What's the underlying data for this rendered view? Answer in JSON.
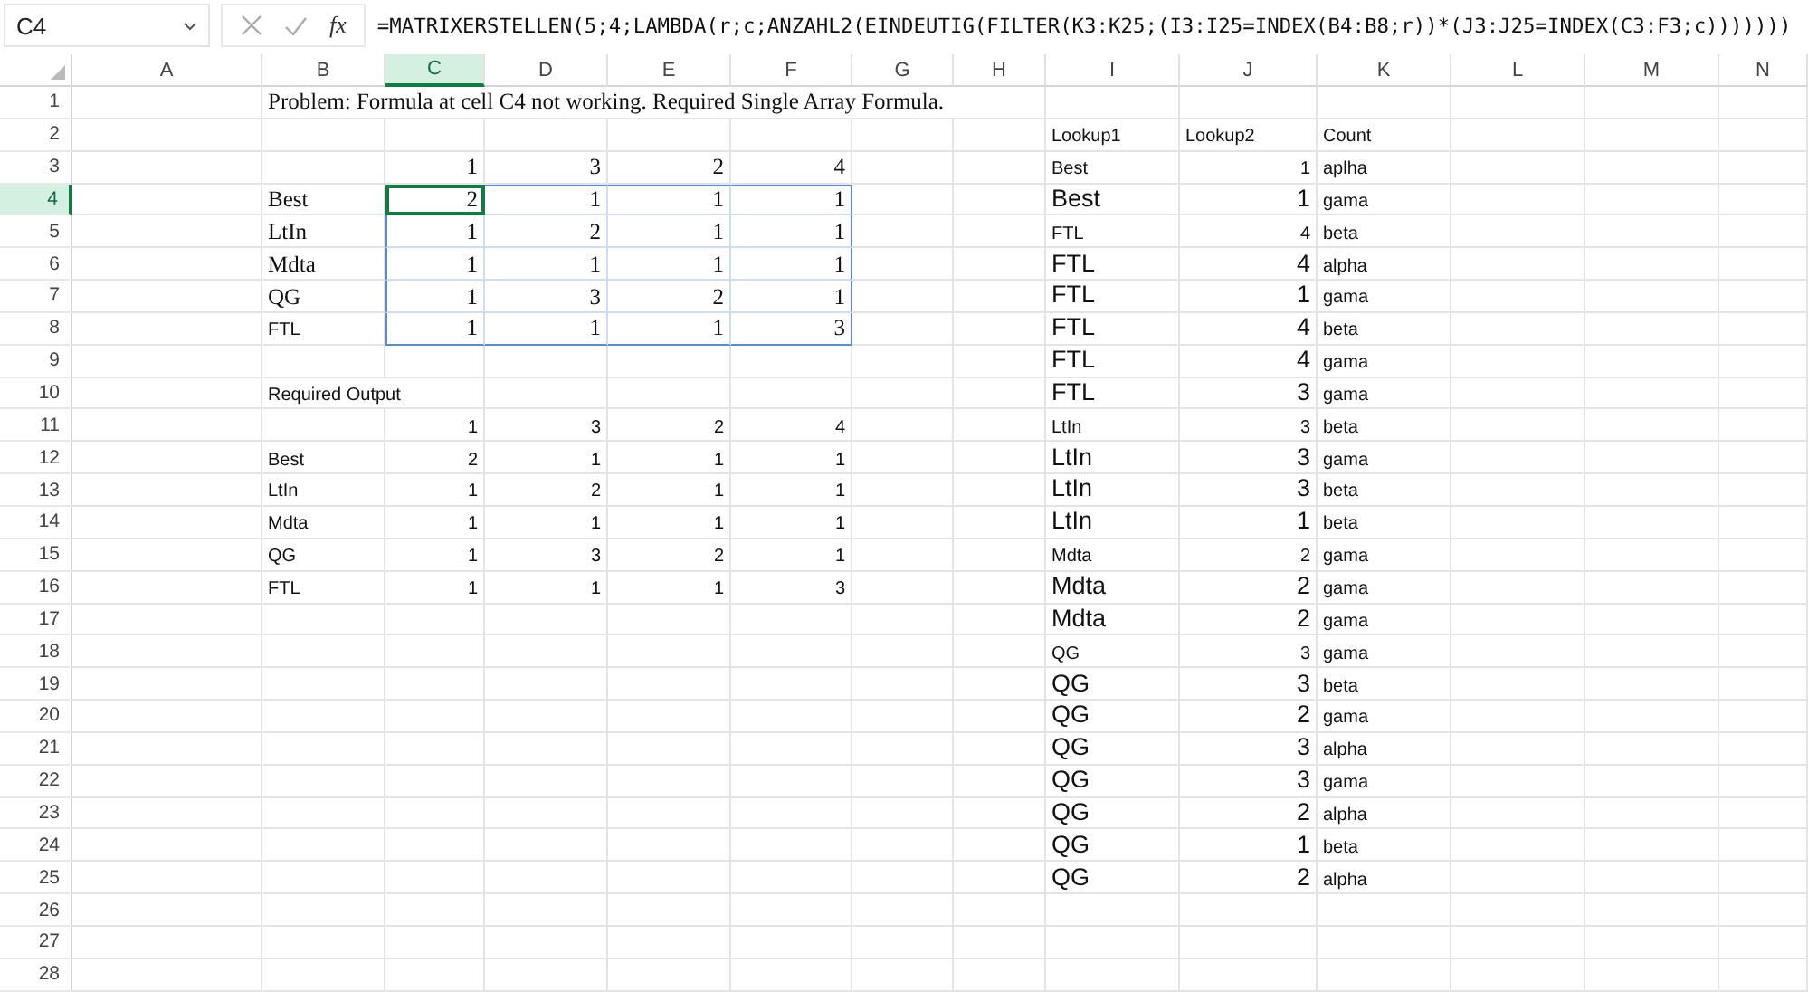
{
  "formula_bar": {
    "name_box": "C4",
    "function_label": "fx",
    "formula": "=MATRIXERSTELLEN(5;4;LAMBDA(r;c;ANZAHL2(EINDEUTIG(FILTER(K3:K25;(I3:I25=INDEX(B4:B8;r))*(J3:J25=INDEX(C3:F3;c)))))))"
  },
  "columns": [
    {
      "label": "A",
      "selected": false
    },
    {
      "label": "B",
      "selected": false
    },
    {
      "label": "C",
      "selected": true
    },
    {
      "label": "D",
      "selected": false
    },
    {
      "label": "E",
      "selected": false
    },
    {
      "label": "F",
      "selected": false
    },
    {
      "label": "G",
      "selected": false
    },
    {
      "label": "H",
      "selected": false
    },
    {
      "label": "I",
      "selected": false
    },
    {
      "label": "J",
      "selected": false
    },
    {
      "label": "K",
      "selected": false
    },
    {
      "label": "L",
      "selected": false
    },
    {
      "label": "M",
      "selected": false
    },
    {
      "label": "N",
      "selected": false
    }
  ],
  "rows": [
    {
      "number": "1",
      "selected": false,
      "cells": {
        "B": {
          "text": "Problem: Formula at cell C4 not working. Required Single Array Formula.",
          "kind": "serif_text",
          "active": false,
          "spill": false
        }
      }
    },
    {
      "number": "2",
      "selected": false,
      "cells": {
        "I": {
          "text": "Lookup1",
          "kind": "sans_text",
          "active": false,
          "spill": false
        },
        "J": {
          "text": "Lookup2",
          "kind": "sans_text",
          "active": false,
          "spill": false
        },
        "K": {
          "text": "Count",
          "kind": "sans_text",
          "active": false,
          "spill": false
        }
      }
    },
    {
      "number": "3",
      "selected": false,
      "cells": {
        "C": {
          "text": "1",
          "kind": "serif_num",
          "active": false,
          "spill": false
        },
        "D": {
          "text": "3",
          "kind": "serif_num",
          "active": false,
          "spill": false
        },
        "E": {
          "text": "2",
          "kind": "serif_num",
          "active": false,
          "spill": false
        },
        "F": {
          "text": "4",
          "kind": "serif_num",
          "active": false,
          "spill": false
        },
        "I": {
          "text": "Best",
          "kind": "sans_text",
          "active": false,
          "spill": false
        },
        "J": {
          "text": "1",
          "kind": "sans_num",
          "active": false,
          "spill": false
        },
        "K": {
          "text": "aplha",
          "kind": "sans_text",
          "active": false,
          "spill": false
        }
      }
    },
    {
      "number": "4",
      "selected": true,
      "cells": {
        "B": {
          "text": "Best",
          "kind": "serif_text",
          "active": false,
          "spill": false
        },
        "C": {
          "text": "2",
          "kind": "serif_num",
          "active": true,
          "spill": true
        },
        "D": {
          "text": "1",
          "kind": "serif_num",
          "active": false,
          "spill": true
        },
        "E": {
          "text": "1",
          "kind": "serif_num",
          "active": false,
          "spill": true
        },
        "F": {
          "text": "1",
          "kind": "serif_num",
          "active": false,
          "spill": true
        },
        "I": {
          "text": "Best",
          "kind": "large_text",
          "active": false,
          "spill": false
        },
        "J": {
          "text": "1",
          "kind": "large_num",
          "active": false,
          "spill": false
        },
        "K": {
          "text": "gama",
          "kind": "sans_text",
          "active": false,
          "spill": false
        }
      }
    },
    {
      "number": "5",
      "selected": false,
      "cells": {
        "B": {
          "text": "LtIn",
          "kind": "serif_text",
          "active": false,
          "spill": false
        },
        "C": {
          "text": "1",
          "kind": "serif_num",
          "active": false,
          "spill": true
        },
        "D": {
          "text": "2",
          "kind": "serif_num",
          "active": false,
          "spill": true
        },
        "E": {
          "text": "1",
          "kind": "serif_num",
          "active": false,
          "spill": true
        },
        "F": {
          "text": "1",
          "kind": "serif_num",
          "active": false,
          "spill": true
        },
        "I": {
          "text": "FTL",
          "kind": "sans_text",
          "active": false,
          "spill": false
        },
        "J": {
          "text": "4",
          "kind": "sans_num",
          "active": false,
          "spill": false
        },
        "K": {
          "text": "beta",
          "kind": "sans_text",
          "active": false,
          "spill": false
        }
      }
    },
    {
      "number": "6",
      "selected": false,
      "cells": {
        "B": {
          "text": "Mdta",
          "kind": "serif_text",
          "active": false,
          "spill": false
        },
        "C": {
          "text": "1",
          "kind": "serif_num",
          "active": false,
          "spill": true
        },
        "D": {
          "text": "1",
          "kind": "serif_num",
          "active": false,
          "spill": true
        },
        "E": {
          "text": "1",
          "kind": "serif_num",
          "active": false,
          "spill": true
        },
        "F": {
          "text": "1",
          "kind": "serif_num",
          "active": false,
          "spill": true
        },
        "I": {
          "text": "FTL",
          "kind": "large_text",
          "active": false,
          "spill": false
        },
        "J": {
          "text": "4",
          "kind": "large_num",
          "active": false,
          "spill": false
        },
        "K": {
          "text": "alpha",
          "kind": "sans_text",
          "active": false,
          "spill": false
        }
      }
    },
    {
      "number": "7",
      "selected": false,
      "cells": {
        "B": {
          "text": "QG",
          "kind": "serif_text",
          "active": false,
          "spill": false
        },
        "C": {
          "text": "1",
          "kind": "serif_num",
          "active": false,
          "spill": true
        },
        "D": {
          "text": "3",
          "kind": "serif_num",
          "active": false,
          "spill": true
        },
        "E": {
          "text": "2",
          "kind": "serif_num",
          "active": false,
          "spill": true
        },
        "F": {
          "text": "1",
          "kind": "serif_num",
          "active": false,
          "spill": true
        },
        "I": {
          "text": "FTL",
          "kind": "large_text",
          "active": false,
          "spill": false
        },
        "J": {
          "text": "1",
          "kind": "large_num",
          "active": false,
          "spill": false
        },
        "K": {
          "text": "gama",
          "kind": "sans_text",
          "active": false,
          "spill": false
        }
      }
    },
    {
      "number": "8",
      "selected": false,
      "cells": {
        "B": {
          "text": "FTL",
          "kind": "sans_text",
          "active": false,
          "spill": false
        },
        "C": {
          "text": "1",
          "kind": "serif_num",
          "active": false,
          "spill": true
        },
        "D": {
          "text": "1",
          "kind": "serif_num",
          "active": false,
          "spill": true
        },
        "E": {
          "text": "1",
          "kind": "serif_num",
          "active": false,
          "spill": true
        },
        "F": {
          "text": "3",
          "kind": "serif_num",
          "active": false,
          "spill": true
        },
        "I": {
          "text": "FTL",
          "kind": "large_text",
          "active": false,
          "spill": false
        },
        "J": {
          "text": "4",
          "kind": "large_num",
          "active": false,
          "spill": false
        },
        "K": {
          "text": "beta",
          "kind": "sans_text",
          "active": false,
          "spill": false
        }
      }
    },
    {
      "number": "9",
      "selected": false,
      "cells": {
        "I": {
          "text": "FTL",
          "kind": "large_text",
          "active": false,
          "spill": false
        },
        "J": {
          "text": "4",
          "kind": "large_num",
          "active": false,
          "spill": false
        },
        "K": {
          "text": "gama",
          "kind": "sans_text",
          "active": false,
          "spill": false
        }
      }
    },
    {
      "number": "10",
      "selected": false,
      "cells": {
        "B": {
          "text": "Required Output",
          "kind": "sans_text",
          "active": false,
          "spill": false
        },
        "I": {
          "text": "FTL",
          "kind": "large_text",
          "active": false,
          "spill": false
        },
        "J": {
          "text": "3",
          "kind": "large_num",
          "active": false,
          "spill": false
        },
        "K": {
          "text": "gama",
          "kind": "sans_text",
          "active": false,
          "spill": false
        }
      }
    },
    {
      "number": "11",
      "selected": false,
      "cells": {
        "C": {
          "text": "1",
          "kind": "sans_num",
          "active": false,
          "spill": false
        },
        "D": {
          "text": "3",
          "kind": "sans_num",
          "active": false,
          "spill": false
        },
        "E": {
          "text": "2",
          "kind": "sans_num",
          "active": false,
          "spill": false
        },
        "F": {
          "text": "4",
          "kind": "sans_num",
          "active": false,
          "spill": false
        },
        "I": {
          "text": "LtIn",
          "kind": "sans_text",
          "active": false,
          "spill": false
        },
        "J": {
          "text": "3",
          "kind": "sans_num",
          "active": false,
          "spill": false
        },
        "K": {
          "text": "beta",
          "kind": "sans_text",
          "active": false,
          "spill": false
        }
      }
    },
    {
      "number": "12",
      "selected": false,
      "cells": {
        "B": {
          "text": "Best",
          "kind": "sans_text",
          "active": false,
          "spill": false
        },
        "C": {
          "text": "2",
          "kind": "sans_num",
          "active": false,
          "spill": false
        },
        "D": {
          "text": "1",
          "kind": "sans_num",
          "active": false,
          "spill": false
        },
        "E": {
          "text": "1",
          "kind": "sans_num",
          "active": false,
          "spill": false
        },
        "F": {
          "text": "1",
          "kind": "sans_num",
          "active": false,
          "spill": false
        },
        "I": {
          "text": "LtIn",
          "kind": "large_text",
          "active": false,
          "spill": false
        },
        "J": {
          "text": "3",
          "kind": "large_num",
          "active": false,
          "spill": false
        },
        "K": {
          "text": "gama",
          "kind": "sans_text",
          "active": false,
          "spill": false
        }
      }
    },
    {
      "number": "13",
      "selected": false,
      "cells": {
        "B": {
          "text": "LtIn",
          "kind": "sans_text",
          "active": false,
          "spill": false
        },
        "C": {
          "text": "1",
          "kind": "sans_num",
          "active": false,
          "spill": false
        },
        "D": {
          "text": "2",
          "kind": "sans_num",
          "active": false,
          "spill": false
        },
        "E": {
          "text": "1",
          "kind": "sans_num",
          "active": false,
          "spill": false
        },
        "F": {
          "text": "1",
          "kind": "sans_num",
          "active": false,
          "spill": false
        },
        "I": {
          "text": "LtIn",
          "kind": "large_text",
          "active": false,
          "spill": false
        },
        "J": {
          "text": "3",
          "kind": "large_num",
          "active": false,
          "spill": false
        },
        "K": {
          "text": "beta",
          "kind": "sans_text",
          "active": false,
          "spill": false
        }
      }
    },
    {
      "number": "14",
      "selected": false,
      "cells": {
        "B": {
          "text": "Mdta",
          "kind": "sans_text",
          "active": false,
          "spill": false
        },
        "C": {
          "text": "1",
          "kind": "sans_num",
          "active": false,
          "spill": false
        },
        "D": {
          "text": "1",
          "kind": "sans_num",
          "active": false,
          "spill": false
        },
        "E": {
          "text": "1",
          "kind": "sans_num",
          "active": false,
          "spill": false
        },
        "F": {
          "text": "1",
          "kind": "sans_num",
          "active": false,
          "spill": false
        },
        "I": {
          "text": "LtIn",
          "kind": "large_text",
          "active": false,
          "spill": false
        },
        "J": {
          "text": "1",
          "kind": "large_num",
          "active": false,
          "spill": false
        },
        "K": {
          "text": "beta",
          "kind": "sans_text",
          "active": false,
          "spill": false
        }
      }
    },
    {
      "number": "15",
      "selected": false,
      "cells": {
        "B": {
          "text": "QG",
          "kind": "sans_text",
          "active": false,
          "spill": false
        },
        "C": {
          "text": "1",
          "kind": "sans_num",
          "active": false,
          "spill": false
        },
        "D": {
          "text": "3",
          "kind": "sans_num",
          "active": false,
          "spill": false
        },
        "E": {
          "text": "2",
          "kind": "sans_num",
          "active": false,
          "spill": false
        },
        "F": {
          "text": "1",
          "kind": "sans_num",
          "active": false,
          "spill": false
        },
        "I": {
          "text": "Mdta",
          "kind": "sans_text",
          "active": false,
          "spill": false
        },
        "J": {
          "text": "2",
          "kind": "sans_num",
          "active": false,
          "spill": false
        },
        "K": {
          "text": "gama",
          "kind": "sans_text",
          "active": false,
          "spill": false
        }
      }
    },
    {
      "number": "16",
      "selected": false,
      "cells": {
        "B": {
          "text": "FTL",
          "kind": "sans_text",
          "active": false,
          "spill": false
        },
        "C": {
          "text": "1",
          "kind": "sans_num",
          "active": false,
          "spill": false
        },
        "D": {
          "text": "1",
          "kind": "sans_num",
          "active": false,
          "spill": false
        },
        "E": {
          "text": "1",
          "kind": "sans_num",
          "active": false,
          "spill": false
        },
        "F": {
          "text": "3",
          "kind": "sans_num",
          "active": false,
          "spill": false
        },
        "I": {
          "text": "Mdta",
          "kind": "large_text",
          "active": false,
          "spill": false
        },
        "J": {
          "text": "2",
          "kind": "large_num",
          "active": false,
          "spill": false
        },
        "K": {
          "text": "gama",
          "kind": "sans_text",
          "active": false,
          "spill": false
        }
      }
    },
    {
      "number": "17",
      "selected": false,
      "cells": {
        "I": {
          "text": "Mdta",
          "kind": "large_text",
          "active": false,
          "spill": false
        },
        "J": {
          "text": "2",
          "kind": "large_num",
          "active": false,
          "spill": false
        },
        "K": {
          "text": "gama",
          "kind": "sans_text",
          "active": false,
          "spill": false
        }
      }
    },
    {
      "number": "18",
      "selected": false,
      "cells": {
        "I": {
          "text": "QG",
          "kind": "sans_text",
          "active": false,
          "spill": false
        },
        "J": {
          "text": "3",
          "kind": "sans_num",
          "active": false,
          "spill": false
        },
        "K": {
          "text": "gama",
          "kind": "sans_text",
          "active": false,
          "spill": false
        }
      }
    },
    {
      "number": "19",
      "selected": false,
      "cells": {
        "I": {
          "text": "QG",
          "kind": "large_text",
          "active": false,
          "spill": false
        },
        "J": {
          "text": "3",
          "kind": "large_num",
          "active": false,
          "spill": false
        },
        "K": {
          "text": "beta",
          "kind": "sans_text",
          "active": false,
          "spill": false
        }
      }
    },
    {
      "number": "20",
      "selected": false,
      "cells": {
        "I": {
          "text": "QG",
          "kind": "large_text",
          "active": false,
          "spill": false
        },
        "J": {
          "text": "2",
          "kind": "large_num",
          "active": false,
          "spill": false
        },
        "K": {
          "text": "gama",
          "kind": "sans_text",
          "active": false,
          "spill": false
        }
      }
    },
    {
      "number": "21",
      "selected": false,
      "cells": {
        "I": {
          "text": "QG",
          "kind": "large_text",
          "active": false,
          "spill": false
        },
        "J": {
          "text": "3",
          "kind": "large_num",
          "active": false,
          "spill": false
        },
        "K": {
          "text": "alpha",
          "kind": "sans_text",
          "active": false,
          "spill": false
        }
      }
    },
    {
      "number": "22",
      "selected": false,
      "cells": {
        "I": {
          "text": "QG",
          "kind": "large_text",
          "active": false,
          "spill": false
        },
        "J": {
          "text": "3",
          "kind": "large_num",
          "active": false,
          "spill": false
        },
        "K": {
          "text": "gama",
          "kind": "sans_text",
          "active": false,
          "spill": false
        }
      }
    },
    {
      "number": "23",
      "selected": false,
      "cells": {
        "I": {
          "text": "QG",
          "kind": "large_text",
          "active": false,
          "spill": false
        },
        "J": {
          "text": "2",
          "kind": "large_num",
          "active": false,
          "spill": false
        },
        "K": {
          "text": "alpha",
          "kind": "sans_text",
          "active": false,
          "spill": false
        }
      }
    },
    {
      "number": "24",
      "selected": false,
      "cells": {
        "I": {
          "text": "QG",
          "kind": "large_text",
          "active": false,
          "spill": false
        },
        "J": {
          "text": "1",
          "kind": "large_num",
          "active": false,
          "spill": false
        },
        "K": {
          "text": "beta",
          "kind": "sans_text",
          "active": false,
          "spill": false
        }
      }
    },
    {
      "number": "25",
      "selected": false,
      "cells": {
        "I": {
          "text": "QG",
          "kind": "large_text",
          "active": false,
          "spill": false
        },
        "J": {
          "text": "2",
          "kind": "large_num",
          "active": false,
          "spill": false
        },
        "K": {
          "text": "alpha",
          "kind": "sans_text",
          "active": false,
          "spill": false
        }
      }
    },
    {
      "number": "26",
      "selected": false,
      "cells": {}
    },
    {
      "number": "27",
      "selected": false,
      "cells": {}
    },
    {
      "number": "28",
      "selected": false,
      "cells": {}
    }
  ]
}
